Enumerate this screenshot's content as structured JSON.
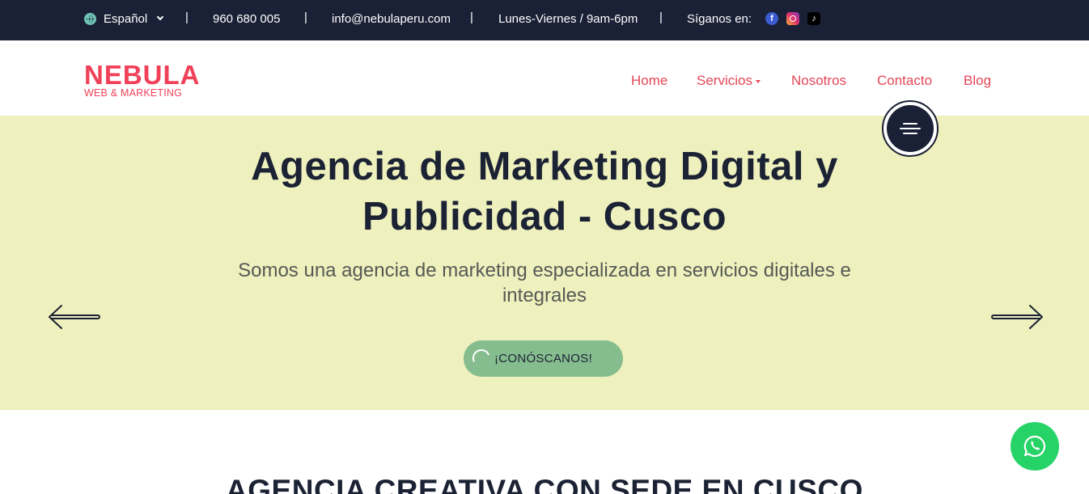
{
  "topbar": {
    "language": "Español",
    "phone": "960 680 005",
    "email": "info@nebulaperu.com",
    "hours": "Lunes-Viernes / 9am-6pm",
    "follow_label": "Síganos en:",
    "separator": "|",
    "socials": [
      "facebook-icon",
      "instagram-icon",
      "tiktok-icon"
    ]
  },
  "brand": {
    "name": "NEBULA",
    "tagline": "WEB & MARKETING",
    "color": "#f04159"
  },
  "nav": {
    "items": [
      "Home",
      "Servicios",
      "Nosotros",
      "Contacto",
      "Blog"
    ],
    "color": "#e54657"
  },
  "hero": {
    "title_line1": "Agencia de Marketing Digital y",
    "title_line2": "Publicidad - Cusco",
    "subtitle": "Somos una agencia de marketing especializada en servicios digitales e integrales",
    "cta": "¡CONÓSCANOS!",
    "background": "#eef0bd"
  },
  "section": {
    "title": "AGENCIA CREATIVA CON SEDE EN CUSCO"
  },
  "colors": {
    "topbar_bg": "#1a2035",
    "cta_bg": "#86bd8f",
    "whatsapp": "#25d366"
  }
}
